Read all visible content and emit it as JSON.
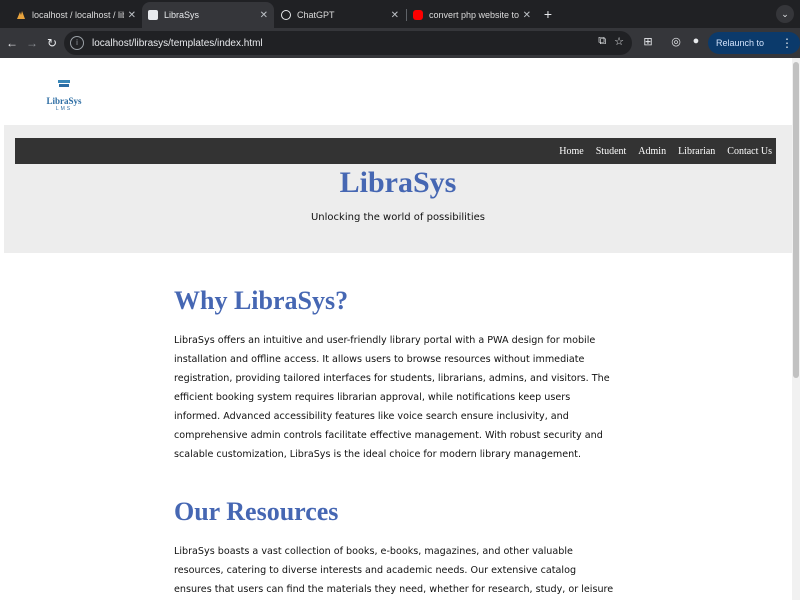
{
  "browser": {
    "tabs": [
      {
        "title": "localhost / localhost / librarysys",
        "favicon_color": "#e8a33d"
      },
      {
        "title": "LibraSys",
        "favicon_color": "#e8eaed"
      },
      {
        "title": "ChatGPT",
        "favicon_color": "#e8eaed"
      },
      {
        "title": "convert php website to pwa",
        "favicon_color": "#ff0000"
      }
    ],
    "new_tab_glyph": "+",
    "url": "localhost/librasys/templates/index.html",
    "relaunch_label": "Relaunch to update"
  },
  "site": {
    "logo": {
      "name": "LibraSys",
      "sub": "LMS"
    },
    "nav": [
      "Home",
      "Student",
      "Admin",
      "Librarian",
      "Contact Us"
    ],
    "hero_title": "LibraSys",
    "hero_tagline": "Unlocking the world of possibilities",
    "sections": [
      {
        "heading": "Why LibraSys?",
        "body": "LibraSys offers an intuitive and user-friendly library portal with a PWA design for mobile installation and offline access. It allows users to browse resources without immediate registration, providing tailored interfaces for students, librarians, admins, and visitors. The efficient booking system requires librarian approval, while notifications keep users informed. Advanced accessibility features like voice search ensure inclusivity, and comprehensive admin controls facilitate effective management. With robust security and scalable customization, LibraSys is the ideal choice for modern library management."
      },
      {
        "heading": "Our Resources",
        "body": "LibraSys boasts a vast collection of books, e-books, magazines, and other valuable resources, catering to diverse interests and academic needs. Our extensive catalog ensures that users can find the materials they need, whether for research, study, or leisure reading. With easy search functionality and"
      }
    ]
  },
  "colors": {
    "accent": "#4667b3",
    "navbar": "#333333",
    "hero_bg": "#ededed"
  }
}
